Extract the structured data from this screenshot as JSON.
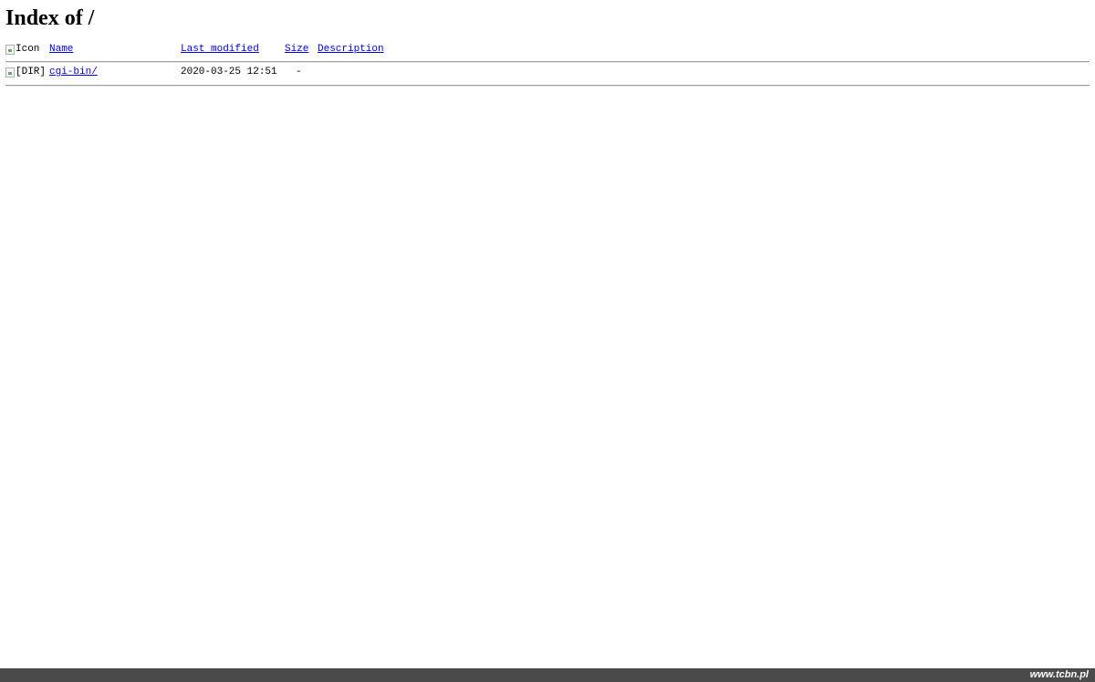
{
  "page": {
    "heading": "Index of /"
  },
  "listing": {
    "columns": {
      "icon_alt": "Icon",
      "name": "Name",
      "last_modified": "Last modified",
      "size": "Size",
      "description": "Description"
    },
    "entries": [
      {
        "icon_alt": "[DIR]",
        "name": "cgi-bin/",
        "last_modified": "2020-03-25 12:51",
        "size": "-",
        "description": ""
      }
    ]
  },
  "footer": {
    "brand": "www.tcbn.pl",
    "background_color": "#4a4a4a"
  },
  "colors": {
    "link": "#0000ee",
    "rule": "#a0a0a0"
  }
}
